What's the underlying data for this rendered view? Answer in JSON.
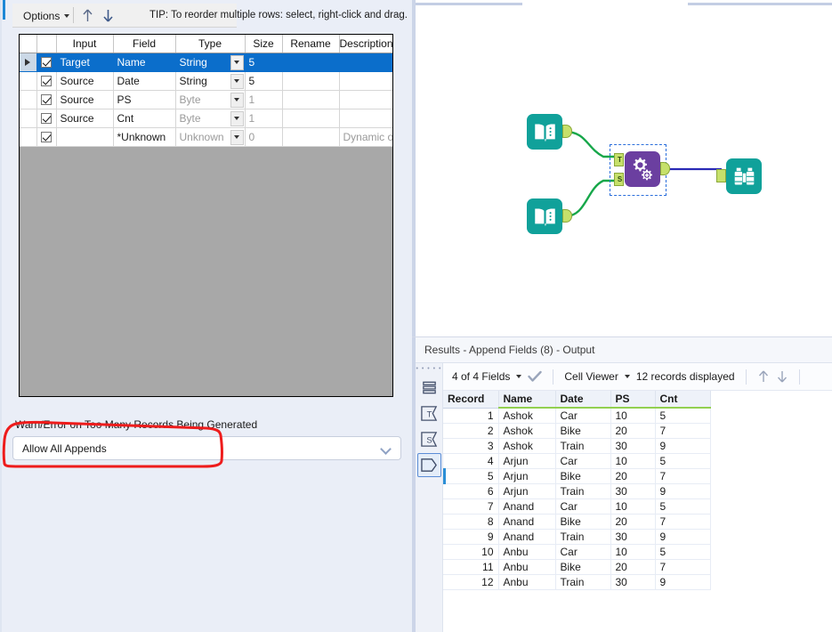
{
  "config_panel": {
    "toolbar": {
      "options_label": "Options",
      "tip": "TIP: To reorder multiple rows: select, right-click and drag.",
      "move_up_icon": "arrow-up-icon",
      "move_down_icon": "arrow-down-icon"
    },
    "field_grid": {
      "columns": [
        "Input",
        "Field",
        "Type",
        "Size",
        "Rename",
        "Description"
      ],
      "rows": [
        {
          "checked": true,
          "input": "Target",
          "field": "Name",
          "type": "String",
          "size": "5",
          "rename": "",
          "description": "",
          "selected": true,
          "dim": false
        },
        {
          "checked": true,
          "input": "Source",
          "field": "Date",
          "type": "String",
          "size": "5",
          "rename": "",
          "description": "",
          "selected": false,
          "dim": false
        },
        {
          "checked": true,
          "input": "Source",
          "field": "PS",
          "type": "Byte",
          "size": "1",
          "rename": "",
          "description": "",
          "selected": false,
          "dim": true
        },
        {
          "checked": true,
          "input": "Source",
          "field": "Cnt",
          "type": "Byte",
          "size": "1",
          "rename": "",
          "description": "",
          "selected": false,
          "dim": true
        },
        {
          "checked": true,
          "input": "",
          "field": "*Unknown",
          "type": "Unknown",
          "size": "0",
          "rename": "",
          "description": "Dynamic or...",
          "selected": false,
          "dim": true
        }
      ]
    },
    "append_option": {
      "label": "Warn/Error on Too Many Records Being Generated",
      "value": "Allow All Appends"
    },
    "annotation": {
      "shape": "red-hand-drawn-rectangle",
      "color": "#ee1c1c"
    }
  },
  "canvas": {
    "nodes": [
      {
        "name": "input-data-node-top",
        "icon": "book-icon",
        "color": "#10a19a",
        "selected": false
      },
      {
        "name": "input-data-node-bottom",
        "icon": "book-icon",
        "color": "#10a19a",
        "selected": false
      },
      {
        "name": "append-fields-node",
        "icon": "gears-plus-icon",
        "color": "#6b3fa0",
        "selected": true,
        "input_anchors": [
          "T",
          "S"
        ]
      },
      {
        "name": "browse-node",
        "icon": "binoculars-icon",
        "color": "#10a19a",
        "selected": false
      }
    ],
    "connection_color_green": "#17a74a",
    "connection_color_blue": "#2a2ab5"
  },
  "results": {
    "title": "Results - Append Fields (8) - Output",
    "toolbar": {
      "fields_selector": "4 of 4 Fields",
      "apply_icon": "checkmark-icon",
      "viewer_selector": "Cell Viewer",
      "record_count": "12 records displayed",
      "prev_icon": "arrow-up-icon",
      "next_icon": "arrow-down-icon"
    },
    "sidebar_icons": [
      "grip-handle-icon",
      "records-list-icon",
      "sigma-t-input-icon",
      "sigma-s-input-icon",
      "output-hexagon-icon"
    ],
    "table": {
      "columns": [
        "Record",
        "Name",
        "Date",
        "PS",
        "Cnt"
      ],
      "rows": [
        [
          "1",
          "Ashok",
          "Car",
          "10",
          "5"
        ],
        [
          "2",
          "Ashok",
          "Bike",
          "20",
          "7"
        ],
        [
          "3",
          "Ashok",
          "Train",
          "30",
          "9"
        ],
        [
          "4",
          "Arjun",
          "Car",
          "10",
          "5"
        ],
        [
          "5",
          "Arjun",
          "Bike",
          "20",
          "7"
        ],
        [
          "6",
          "Arjun",
          "Train",
          "30",
          "9"
        ],
        [
          "7",
          "Anand",
          "Car",
          "10",
          "5"
        ],
        [
          "8",
          "Anand",
          "Bike",
          "20",
          "7"
        ],
        [
          "9",
          "Anand",
          "Train",
          "30",
          "9"
        ],
        [
          "10",
          "Anbu",
          "Car",
          "10",
          "5"
        ],
        [
          "11",
          "Anbu",
          "Bike",
          "20",
          "7"
        ],
        [
          "12",
          "Anbu",
          "Train",
          "30",
          "9"
        ]
      ]
    }
  }
}
